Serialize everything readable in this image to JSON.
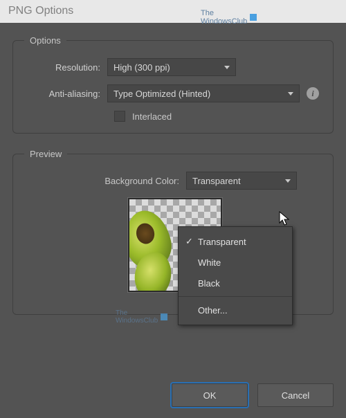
{
  "title": "PNG Options",
  "watermark": {
    "text": "The\nWindowsClub"
  },
  "options_group": {
    "legend": "Options",
    "resolution_label": "Resolution:",
    "resolution_value": "High (300 ppi)",
    "anti_aliasing_label": "Anti-aliasing:",
    "anti_aliasing_value": "Type Optimized (Hinted)",
    "interlaced_label": "Interlaced",
    "interlaced_checked": false
  },
  "preview_group": {
    "legend": "Preview",
    "bgcolor_label": "Background Color:",
    "bgcolor_value": "Transparent",
    "bgcolor_options": [
      "Transparent",
      "White",
      "Black",
      "Other..."
    ],
    "bgcolor_selected_index": 0
  },
  "buttons": {
    "ok": "OK",
    "cancel": "Cancel"
  }
}
